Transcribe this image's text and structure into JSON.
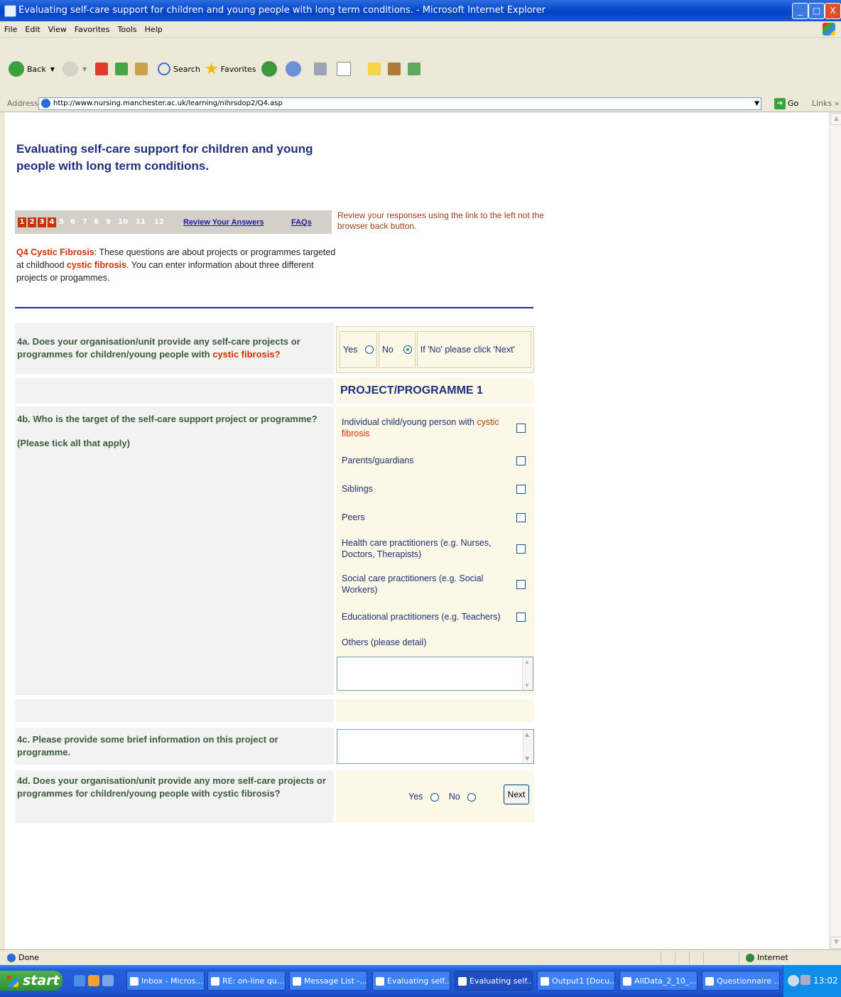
{
  "window": {
    "title": "Evaluating self-care support for children and young people with long term conditions. - Microsoft Internet Explorer",
    "controls": [
      "_",
      "□",
      "X"
    ]
  },
  "menu": [
    "File",
    "Edit",
    "View",
    "Favorites",
    "Tools",
    "Help"
  ],
  "toolbar": {
    "back": "Back",
    "search": "Search",
    "favorites": "Favorites"
  },
  "address": {
    "label": "Address",
    "url": "http://www.nursing.manchester.ac.uk/learning/nihrsdop2/Q4.asp",
    "go": "Go",
    "links": "Links"
  },
  "page": {
    "title": "Evaluating self-care support for children and young people with long term conditions.",
    "pager": {
      "pages": [
        {
          "n": "1",
          "active": true
        },
        {
          "n": "2",
          "active": true
        },
        {
          "n": "3",
          "active": true
        },
        {
          "n": "4",
          "active": true
        },
        {
          "n": "5",
          "active": false
        },
        {
          "n": "6",
          "active": false
        },
        {
          "n": "7",
          "active": false
        },
        {
          "n": "8",
          "active": false
        },
        {
          "n": "9",
          "active": false
        },
        {
          "n": "10",
          "active": false
        },
        {
          "n": "11",
          "active": false
        },
        {
          "n": "12",
          "active": false
        }
      ],
      "review_link": "Review Your Answers",
      "faqs_link": "FAQs"
    },
    "review_note": "Review your responses using the link to the left not the browser back button.",
    "intro": {
      "label": "Q4 Cystic Fibrosis",
      "text_a": ": These questions are about projects or programmes targeted at childhood ",
      "highlight": "cystic fibrosis",
      "text_b": ". You can enter information about three different projects or progammes."
    },
    "q4a": {
      "text": "4a. Does your organisation/unit provide any self-care projects or programmes for children/young people with ",
      "highlight": "cystic fibrosis?",
      "yes": "Yes",
      "no": "No",
      "selected": "No",
      "hint": "If 'No' please click 'Next'"
    },
    "project_heading": "PROJECT/PROGRAMME 1",
    "q4b": {
      "text": "4b. Who is the target of the self-care support project or programme?",
      "note": "(Please tick all that apply)",
      "options": [
        {
          "pre": "Individual child/young person with ",
          "highlight": "cystic fibrosis",
          "checked": false
        },
        {
          "pre": "Parents/guardians",
          "highlight": "",
          "checked": false
        },
        {
          "pre": "Siblings",
          "highlight": "",
          "checked": false
        },
        {
          "pre": "Peers",
          "highlight": "",
          "checked": false
        },
        {
          "pre": "Health care practitioners (e.g. Nurses, Doctors, Therapists)",
          "highlight": "",
          "checked": false
        },
        {
          "pre": "Social care practitioners (e.g. Social Workers)",
          "highlight": "",
          "checked": false
        },
        {
          "pre": "Educational practitioners (e.g. Teachers)",
          "highlight": "",
          "checked": false
        }
      ],
      "others_label": "Others (please detail)",
      "others_value": ""
    },
    "q4c": {
      "text": "4c. Please provide some brief information on this project or programme.",
      "value": ""
    },
    "q4d": {
      "text": "4d. Does your organisation/unit provide any more self-care projects or programmes for children/young people with cystic fibrosis?",
      "yes": "Yes",
      "no": "No",
      "next": "Next"
    }
  },
  "status": {
    "text": "Done",
    "zone": "Internet"
  },
  "taskbar": {
    "start": "start",
    "tasks": [
      {
        "label": "Inbox - Micros...",
        "active": false
      },
      {
        "label": "RE: on-line qu...",
        "active": false
      },
      {
        "label": "Message List -...",
        "active": false
      },
      {
        "label": "Evaluating self...",
        "active": false
      },
      {
        "label": "Evaluating self...",
        "active": true
      },
      {
        "label": "Output1 [Docu...",
        "active": false
      },
      {
        "label": "AllData_2_10_...",
        "active": false
      },
      {
        "label": "Questionnaire ...",
        "active": false
      }
    ],
    "clock": "13:02"
  }
}
